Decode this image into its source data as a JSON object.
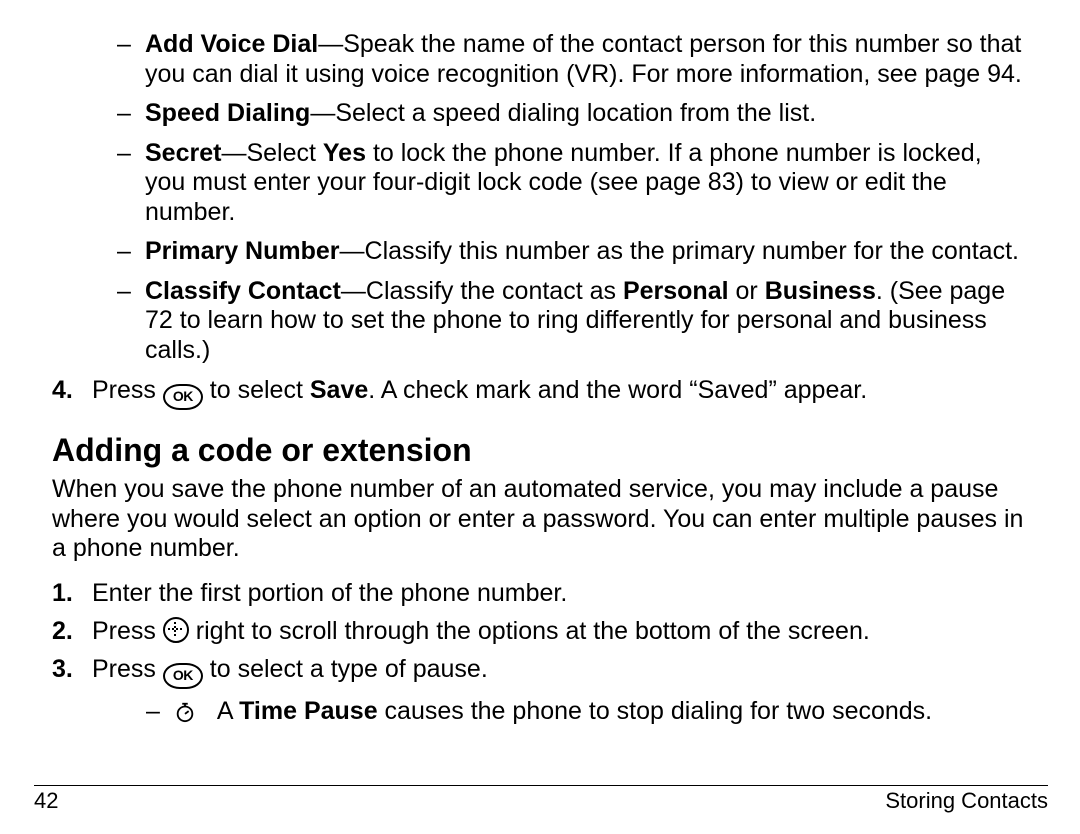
{
  "sub_items": [
    {
      "title": "Add Voice Dial",
      "body": "—Speak the name of the contact person for this number so that you can dial it using voice recognition (VR). For more information, see page 94."
    },
    {
      "title": "Speed Dialing",
      "body": "—Select a speed dialing location from the list."
    },
    {
      "title": "Secret",
      "body_pre": "—Select ",
      "body_bold": "Yes",
      "body_post": " to lock the phone number. If a phone number is locked, you must enter your four-digit lock code (see page 83) to view or edit the number."
    },
    {
      "title": "Primary Number",
      "body": "—Classify this number as the primary number for the contact."
    },
    {
      "title": "Classify Contact",
      "body_pre": "—Classify the contact as ",
      "body_bold": "Personal",
      "body_mid": " or ",
      "body_bold2": "Business",
      "body_post": ". (See page 72 to learn how to set the phone to ring differently for personal and business calls.)"
    }
  ],
  "step4": {
    "num": "4.",
    "pre": "Press  ",
    "mid": "  to select ",
    "save": "Save",
    "post": ". A check mark and the word “Saved” appear."
  },
  "heading": "Adding a code or extension",
  "intro": "When you save the phone number of an automated service, you may include a pause where you would select an option or enter a password. You can enter multiple pauses in a phone number.",
  "steps": [
    {
      "num": "1.",
      "text": "Enter the first portion of the phone number."
    },
    {
      "num": "2.",
      "pre": "Press  ",
      "post": "  right to scroll through the options at the bottom of the screen."
    },
    {
      "num": "3.",
      "pre": "Press  ",
      "post": "  to select a type of pause."
    }
  ],
  "pause_item": {
    "pre": "A ",
    "bold": "Time Pause",
    "post": " causes the phone to stop dialing for two seconds."
  },
  "footer": {
    "page": "42",
    "section": "Storing Contacts"
  },
  "icons": {
    "ok": "OK"
  }
}
